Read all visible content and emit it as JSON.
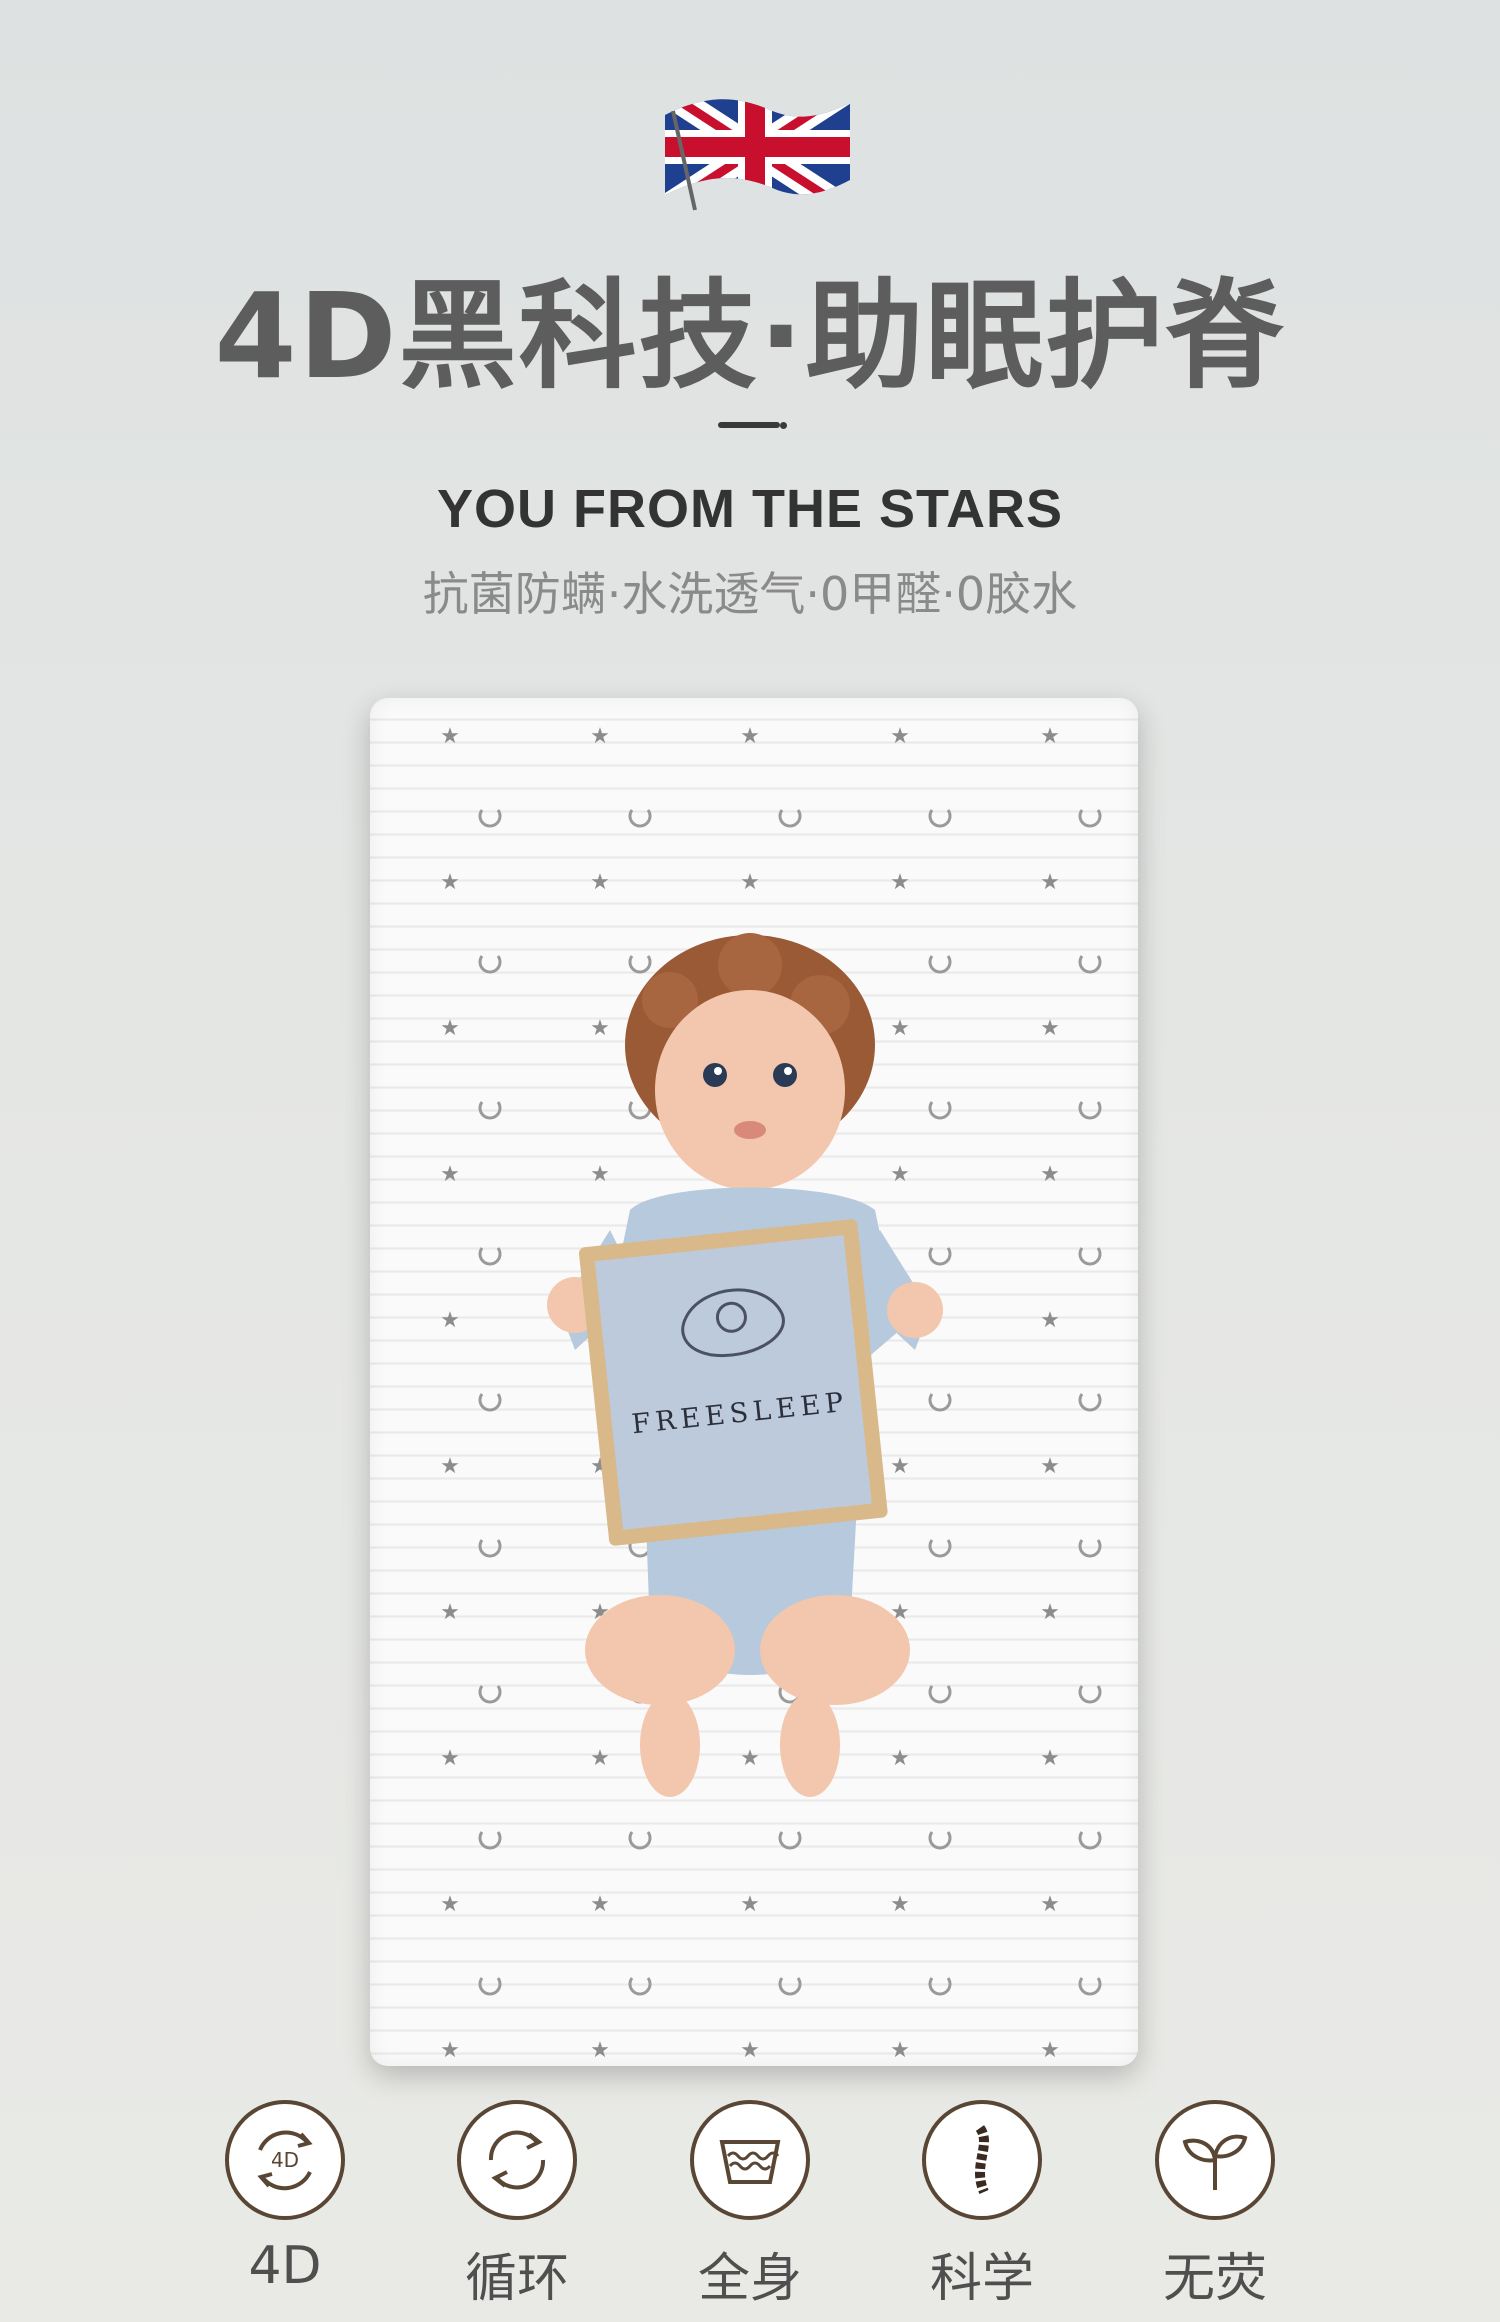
{
  "hero": {
    "title": "4D黑科技·助眠护脊",
    "subtitle_en": "YOU FROM THE STARS",
    "subtitle_cn": "抗菌防螨·水洗透气·0甲醛·0胶水"
  },
  "product": {
    "board_brand": "FREESLEEP"
  },
  "features": [
    {
      "label": "4D",
      "icon": "4d-rotate-icon",
      "icon_text": "4D"
    },
    {
      "label": "循环",
      "icon": "cycle-arrows-icon"
    },
    {
      "label": "全身",
      "icon": "water-wave-icon"
    },
    {
      "label": "科学",
      "icon": "spine-icon"
    },
    {
      "label": "无荧",
      "icon": "sprout-icon"
    }
  ],
  "colors": {
    "title": "#5d5d5d",
    "icon_stroke": "#5a4634",
    "mattress": "#fafafa"
  }
}
